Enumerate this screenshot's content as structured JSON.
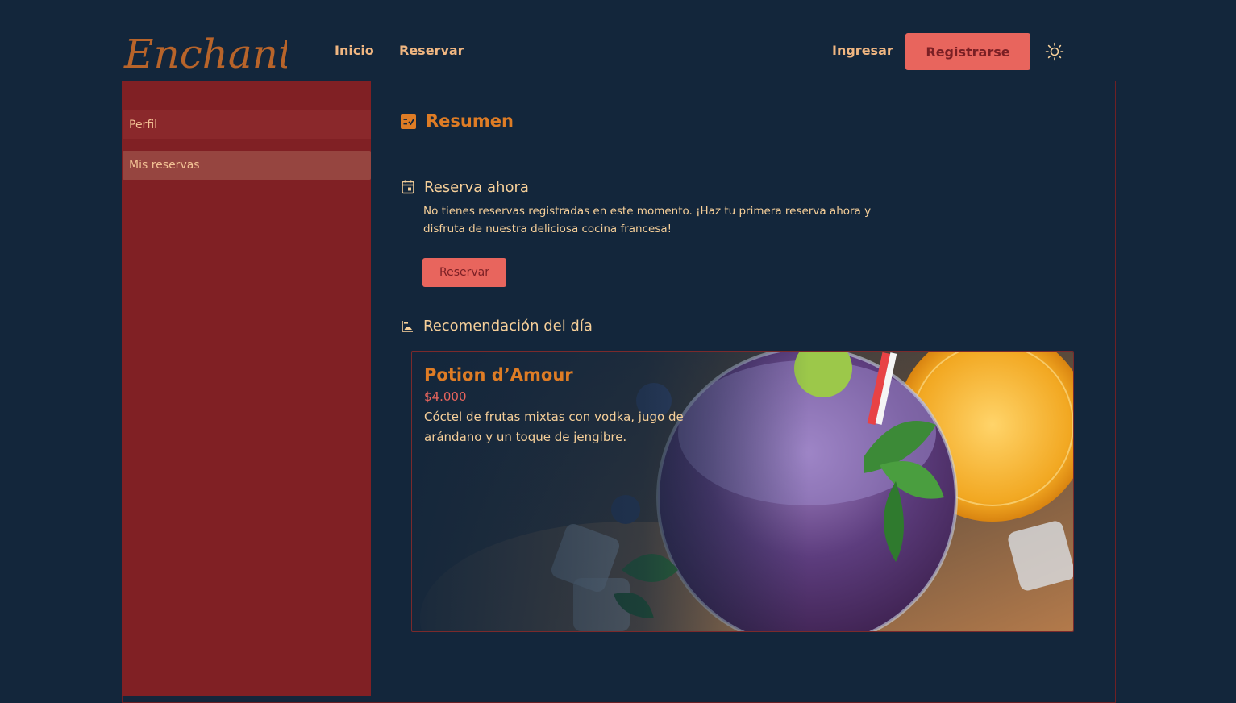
{
  "brand": {
    "logo_text": "Enchanté"
  },
  "nav": {
    "links": [
      "Inicio",
      "Reservar"
    ],
    "login_label": "Ingresar",
    "register_label": "Registrarse",
    "theme_icon": "sun-icon"
  },
  "sidebar": {
    "items": [
      {
        "label": "Perfil",
        "active": false
      },
      {
        "label": "Mis reservas",
        "active": true
      }
    ]
  },
  "main": {
    "title": "Resumen",
    "reserve_section": {
      "heading": "Reserva ahora",
      "text": "No tienes reservas registradas en este momento. ¡Haz tu primera reserva ahora y disfruta de nuestra deliciosa cocina francesa!",
      "button_label": "Reservar"
    },
    "recommendation": {
      "heading": "Recomendación del día",
      "dish_name": "Potion d’Amour",
      "price": "$4.000",
      "description": "Cóctel de frutas mixtas con vodka, jugo de arándano y un toque de jengibre."
    }
  },
  "colors": {
    "background": "#13263b",
    "sidebar": "#802024",
    "accent": "#e8655d",
    "heading_orange": "#de7c25",
    "text_cream": "#f6cf99"
  }
}
